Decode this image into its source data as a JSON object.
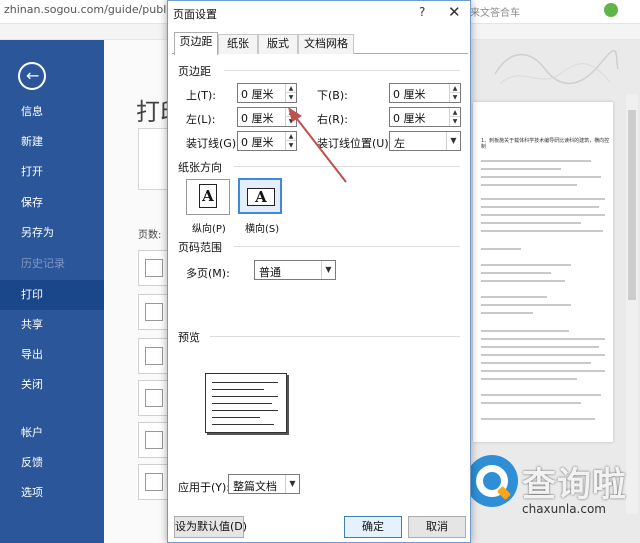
{
  "browser": {
    "url": "zhinan.sogou.com/guide/publish?",
    "right_text": "来文答合车"
  },
  "sidebar": {
    "items": [
      {
        "label": "信息"
      },
      {
        "label": "新建"
      },
      {
        "label": "打开"
      },
      {
        "label": "保存"
      },
      {
        "label": "另存为"
      },
      {
        "label": "历史记录"
      },
      {
        "label": "打印"
      },
      {
        "label": "共享"
      },
      {
        "label": "导出"
      },
      {
        "label": "关闭"
      },
      {
        "label": "帐户"
      },
      {
        "label": "反馈"
      },
      {
        "label": "选项"
      }
    ],
    "active_index": 6
  },
  "backstage": {
    "title": "打印",
    "pages_label": "页数:"
  },
  "document": {
    "heading": "1、刺板施关于载体科学技术编导研比读科的建筑，横向控制"
  },
  "dialog": {
    "title": "页面设置",
    "help": "?",
    "close": "✕",
    "tabs": [
      {
        "label": "页边距"
      },
      {
        "label": "纸张"
      },
      {
        "label": "版式"
      },
      {
        "label": "文档网格"
      }
    ],
    "margins": {
      "section": "页边距",
      "top_label": "上(T):",
      "top_value": "0 厘米",
      "bottom_label": "下(B):",
      "bottom_value": "0 厘米",
      "left_label": "左(L):",
      "left_value": "0 厘米",
      "right_label": "右(R):",
      "right_value": "0 厘米",
      "gutter_label": "装订线(G):",
      "gutter_value": "0 厘米",
      "gutter_pos_label": "装订线位置(U):",
      "gutter_pos_value": "左"
    },
    "orientation": {
      "section": "纸张方向",
      "portrait_label": "纵向(P)",
      "landscape_label": "横向(S)",
      "glyph": "A"
    },
    "pages": {
      "section": "页码范围",
      "multiple_label": "多页(M):",
      "multiple_value": "普通"
    },
    "preview": {
      "section": "预览"
    },
    "apply": {
      "label": "应用于(Y):",
      "value": "整篇文档"
    },
    "buttons": {
      "set_default": "设为默认值(D)",
      "ok": "确定",
      "cancel": "取消"
    }
  },
  "watermark": {
    "name": "查询啦",
    "domain": "chaxunla.com"
  },
  "colors": {
    "sidebar": "#2b579a",
    "sidebar_active": "#19478a",
    "selected_border": "#3c8ad8",
    "annotation_arrow": "#c0504d"
  }
}
